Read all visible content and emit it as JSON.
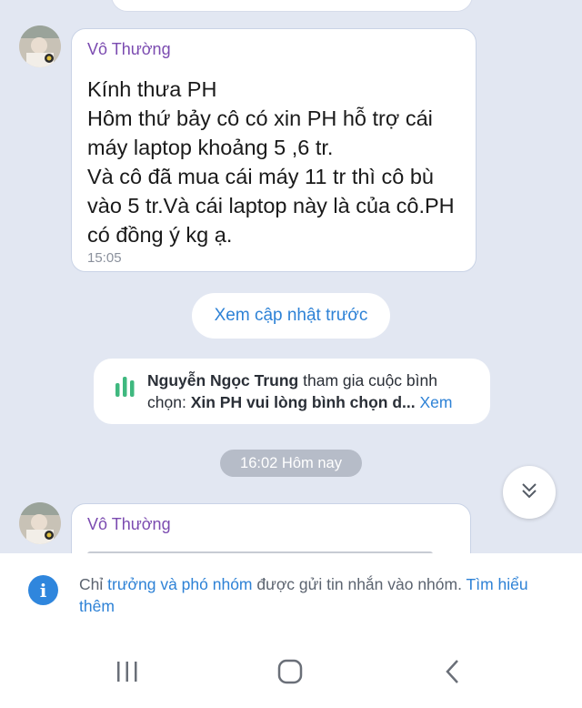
{
  "messages": [
    {
      "sender": "Vô Thường",
      "text": "Kính thưa PH\nHôm thứ bảy cô có xin PH hỗ trợ cái máy laptop khoảng 5 ,6 tr.\nVà cô đã mua cái máy 11 tr thì cô bù vào 5 tr.Và cái laptop này là của cô.PH có đồng ý kg ạ.",
      "time": "15:05"
    },
    {
      "sender": "Vô Thường"
    }
  ],
  "load_previous_label": "Xem cập nhật trước",
  "poll_notice": {
    "actor": "Nguyễn Ngọc Trung",
    "action": " tham gia cuộc bình chọn: ",
    "poll_title": "Xin PH vui lòng bình chọn d...",
    "more_label": " Xem"
  },
  "date_divider": "16:02 Hôm nay",
  "footer_notice": {
    "prefix": "Chỉ ",
    "roles": "trưởng và phó nhóm",
    "middle": " được gửi tin nhắn vào nhóm. ",
    "learn_more": "Tìm hiểu thêm"
  },
  "colors": {
    "background": "#e2e7f2",
    "sender_name": "#7b4bb0",
    "link": "#2e82d6",
    "poll_icon": "#3fb87f",
    "date_chip": "#b6bcc8"
  },
  "icons": {
    "poll": "poll-bars-icon",
    "scroll_down": "double-chevron-down-icon",
    "info": "info-icon",
    "nav_recents": "recents-icon",
    "nav_home": "home-icon",
    "nav_back": "back-icon"
  }
}
